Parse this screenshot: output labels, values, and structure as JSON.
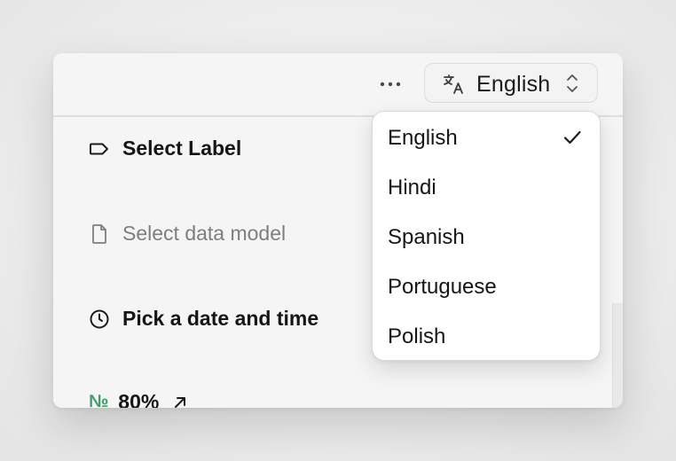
{
  "header": {
    "more_icon": "ellipsis-icon",
    "language_select": {
      "icon": "translate-icon",
      "value": "English",
      "chevron_icon": "chevron-up-down-icon"
    }
  },
  "fields": [
    {
      "icon": "tag-icon",
      "label": "Select Label"
    },
    {
      "icon": "file-icon",
      "placeholder": "Select data model"
    },
    {
      "icon": "clock-icon",
      "label": "Pick a date and time"
    },
    {
      "icon": "number-sign-icon",
      "sign": "№",
      "label": "80%",
      "trail_icon": "arrow-up-right-icon"
    }
  ],
  "language_dropdown": {
    "selected": "English",
    "options": [
      "English",
      "Hindi",
      "Spanish",
      "Portuguese",
      "Polish"
    ],
    "check_icon": "check-icon"
  },
  "colors": {
    "accent_green": "#3aa16b",
    "text": "#151515",
    "muted": "#7e7e7e"
  }
}
